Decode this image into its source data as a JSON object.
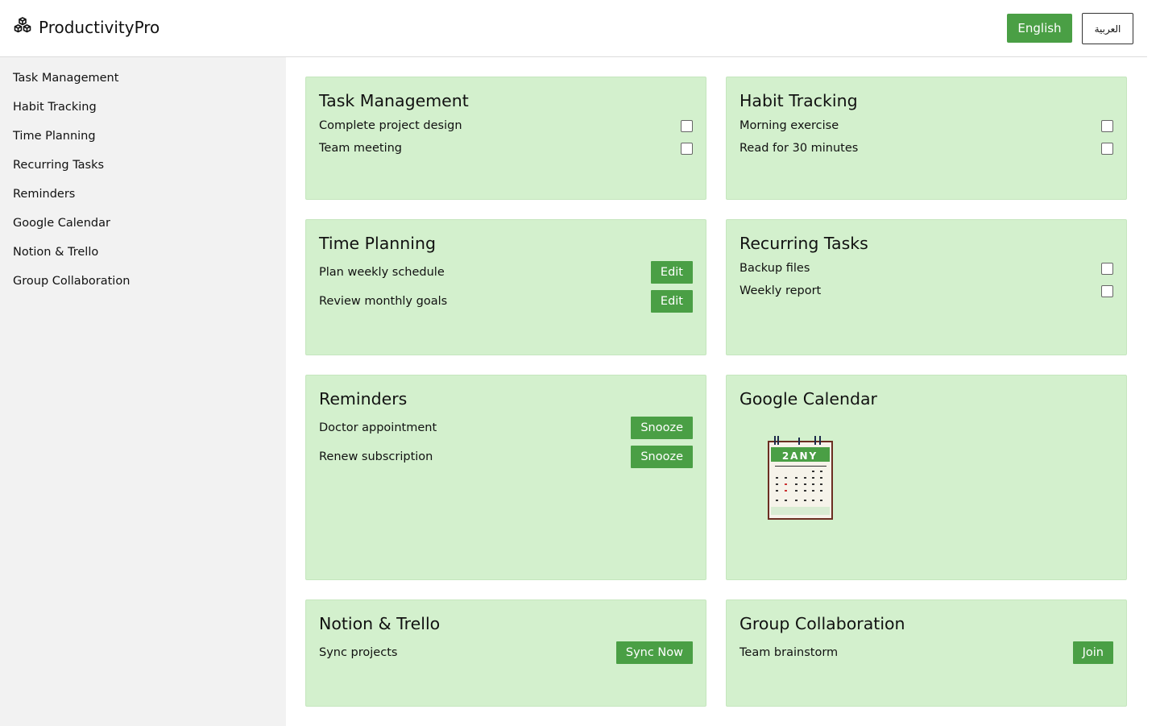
{
  "header": {
    "brand_icon": "cubes-icon",
    "brand_name": "ProductivityPro",
    "lang_english": "English",
    "lang_arabic": "العربية"
  },
  "sidebar": {
    "items": [
      {
        "label": "Task Management"
      },
      {
        "label": "Habit Tracking"
      },
      {
        "label": "Time Planning"
      },
      {
        "label": "Recurring Tasks"
      },
      {
        "label": "Reminders"
      },
      {
        "label": "Google Calendar"
      },
      {
        "label": "Notion & Trello"
      },
      {
        "label": "Group Collaboration"
      }
    ]
  },
  "cards": {
    "task_management": {
      "title": "Task Management",
      "items": [
        {
          "label": "Complete project design",
          "checked": false
        },
        {
          "label": "Team meeting",
          "checked": false
        }
      ]
    },
    "habit_tracking": {
      "title": "Habit Tracking",
      "items": [
        {
          "label": "Morning exercise",
          "checked": false
        },
        {
          "label": "Read for 30 minutes",
          "checked": false
        }
      ]
    },
    "time_planning": {
      "title": "Time Planning",
      "items": [
        {
          "label": "Plan weekly schedule",
          "action": "Edit"
        },
        {
          "label": "Review monthly goals",
          "action": "Edit"
        }
      ]
    },
    "recurring_tasks": {
      "title": "Recurring Tasks",
      "items": [
        {
          "label": "Backup files",
          "checked": false
        },
        {
          "label": "Weekly report",
          "checked": false
        }
      ]
    },
    "reminders": {
      "title": "Reminders",
      "items": [
        {
          "label": "Doctor appointment",
          "action": "Snooze"
        },
        {
          "label": "Renew subscription",
          "action": "Snooze"
        }
      ]
    },
    "google_calendar": {
      "title": "Google Calendar",
      "calendar_image": {
        "icon": "calendar-image",
        "header_text": "2ANY"
      }
    },
    "notion_trello": {
      "title": "Notion & Trello",
      "items": [
        {
          "label": "Sync projects",
          "action": "Sync Now"
        }
      ]
    },
    "group_collaboration": {
      "title": "Group Collaboration",
      "items": [
        {
          "label": "Team brainstorm",
          "action": "Join"
        }
      ]
    }
  },
  "colors": {
    "accent": "#4a9f45",
    "card_bg": "#d3f0cd",
    "sidebar_bg": "#f2f2f2"
  }
}
